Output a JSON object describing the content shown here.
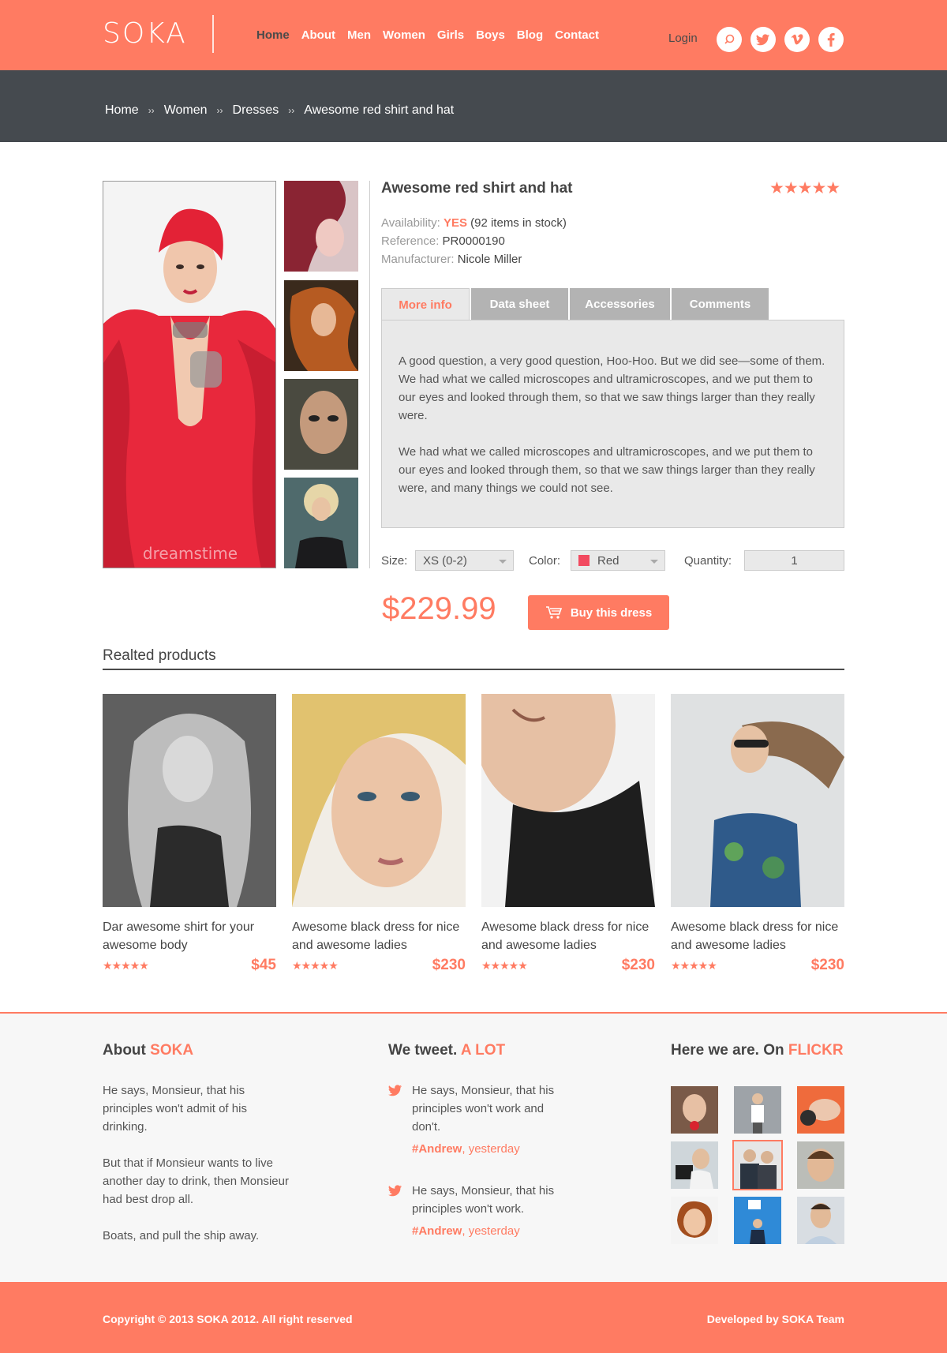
{
  "header": {
    "logo": "SOKA",
    "nav": [
      "Home",
      "About",
      "Men",
      "Women",
      "Girls",
      "Boys",
      "Blog",
      "Contact"
    ],
    "active_nav": "Home",
    "login": "Login",
    "socials": [
      "search-icon",
      "twitter-icon",
      "vimeo-icon",
      "facebook-icon"
    ]
  },
  "breadcrumb": [
    "Home",
    "Women",
    "Dresses",
    "Awesome red shirt and hat"
  ],
  "breadcrumb_separator": "››",
  "product": {
    "title": "Awesome red shirt and hat",
    "rating": 4.5,
    "rating_text": "★★★★★",
    "availability_label": "Availability:",
    "availability_value": "YES",
    "availability_stock": "(92 items in stock)",
    "reference_label": "Reference:",
    "reference_value": "PR0000190",
    "manufacturer_label": "Manufacturer:",
    "manufacturer_value": "Nicole Miller",
    "tabs": [
      "More info",
      "Data sheet",
      "Accessories",
      "Comments"
    ],
    "active_tab": "More info",
    "description": [
      "A good question, a very good question, Hoo-Hoo. But we did see—some of them. We had what we called microscopes and ultramicroscopes, and we put them to our eyes and looked through them, so that we saw things larger than they really were.",
      "We had what we called microscopes and ultramicroscopes, and we put them to our eyes and looked through them, so that we saw things larger than they really were, and many things we could not see."
    ],
    "size_label": "Size:",
    "size_value": "XS (0-2)",
    "color_label": "Color:",
    "color_value": "Red",
    "color_swatch": "#f24a60",
    "quantity_label": "Quantity:",
    "quantity_value": "1",
    "price": "$229.99",
    "buy_label": "Buy this dress"
  },
  "related": {
    "title": "Realted products",
    "items": [
      {
        "name": "Dar awesome shirt for your awesome body",
        "price": "$45",
        "stars": "★★★★★"
      },
      {
        "name": "Awesome black dress for nice and awesome ladies",
        "price": "$230",
        "stars": "★★★★★"
      },
      {
        "name": "Awesome black dress for nice and awesome ladies",
        "price": "$230",
        "stars": "★★★★★"
      },
      {
        "name": "Awesome black dress for nice and awesome ladies",
        "price": "$230",
        "stars": "★★★★★"
      }
    ]
  },
  "footer": {
    "about_title": "About",
    "about_accent": "SOKA",
    "about_paragraphs": [
      "He says, Monsieur, that his principles won't admit of his drinking.",
      "But that if Monsieur wants to live another day to drink, then Monsieur had best drop all.",
      "Boats, and pull the ship away."
    ],
    "tweets_title": "We tweet.",
    "tweets_accent": "A LOT",
    "tweets": [
      {
        "text": "He says, Monsieur, that his principles won't work and don't.",
        "author": "#Andrew",
        "when": ", yesterday"
      },
      {
        "text": "He says, Monsieur, that his principles won't work.",
        "author": "#Andrew",
        "when": ", yesterday"
      }
    ],
    "flickr_title": "Here we are. On",
    "flickr_accent": "FLICKR",
    "copyright": "Copyright © 2013 SOKA 2012. All right reserved",
    "developed": "Developed by SOKA Team"
  },
  "colors": {
    "accent": "#ff7b62",
    "dark_bar": "#454a4f"
  }
}
